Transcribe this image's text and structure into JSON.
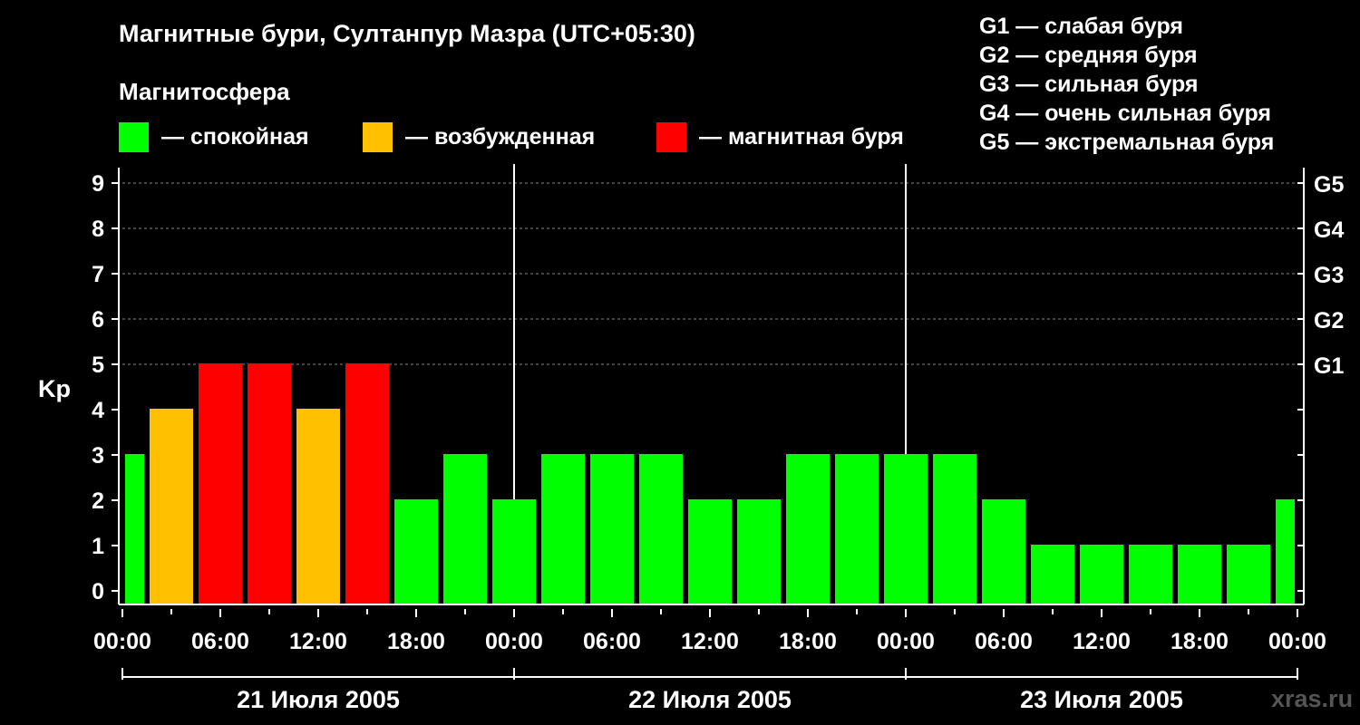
{
  "title": "Магнитные бури, Султанпур Мазра (UTC+05:30)",
  "subtitle": "Магнитосфера",
  "legend": [
    {
      "label": "— спокойная",
      "color": "#00ff00"
    },
    {
      "label": "— возбужденная",
      "color": "#ffc000"
    },
    {
      "label": "— магнитная буря",
      "color": "#ff0000"
    }
  ],
  "g_scale": [
    "G1 — слабая буря",
    "G2 — средняя буря",
    "G3 — сильная буря",
    "G4 — очень сильная буря",
    "G5 — экстремальная буря"
  ],
  "watermark": "xras.ru",
  "chart_data": {
    "type": "bar",
    "ylabel": "Kp",
    "ylim": [
      0,
      9
    ],
    "yticks": [
      "0",
      "1",
      "2",
      "3",
      "4",
      "5",
      "6",
      "7",
      "8",
      "9"
    ],
    "right_ticks": [
      {
        "value": 5,
        "label": "G1"
      },
      {
        "value": 6,
        "label": "G2"
      },
      {
        "value": 7,
        "label": "G3"
      },
      {
        "value": 8,
        "label": "G4"
      },
      {
        "value": 9,
        "label": "G5"
      }
    ],
    "xticks": [
      "00:00",
      "06:00",
      "12:00",
      "18:00",
      "00:00",
      "06:00",
      "12:00",
      "18:00",
      "00:00",
      "06:00",
      "12:00",
      "18:00",
      "00:00"
    ],
    "days": [
      "21 Июля 2005",
      "22 Июля 2005",
      "23 Июля 2005"
    ],
    "grid": "dashed horizontal lines at 5-9",
    "bars": [
      {
        "start": "21 00:00",
        "value": 3,
        "status": "calm"
      },
      {
        "start": "21 01:30",
        "value": 4,
        "status": "disturbed"
      },
      {
        "start": "21 04:30",
        "value": 5,
        "status": "storm"
      },
      {
        "start": "21 07:30",
        "value": 5,
        "status": "storm"
      },
      {
        "start": "21 10:30",
        "value": 4,
        "status": "disturbed"
      },
      {
        "start": "21 13:30",
        "value": 5,
        "status": "storm"
      },
      {
        "start": "21 16:30",
        "value": 2,
        "status": "calm"
      },
      {
        "start": "21 19:30",
        "value": 3,
        "status": "calm"
      },
      {
        "start": "21 22:30",
        "value": 2,
        "status": "calm"
      },
      {
        "start": "22 01:30",
        "value": 3,
        "status": "calm"
      },
      {
        "start": "22 04:30",
        "value": 3,
        "status": "calm"
      },
      {
        "start": "22 07:30",
        "value": 3,
        "status": "calm"
      },
      {
        "start": "22 10:30",
        "value": 2,
        "status": "calm"
      },
      {
        "start": "22 13:30",
        "value": 2,
        "status": "calm"
      },
      {
        "start": "22 16:30",
        "value": 3,
        "status": "calm"
      },
      {
        "start": "22 19:30",
        "value": 3,
        "status": "calm"
      },
      {
        "start": "22 22:30",
        "value": 3,
        "status": "calm"
      },
      {
        "start": "23 01:30",
        "value": 3,
        "status": "calm"
      },
      {
        "start": "23 04:30",
        "value": 2,
        "status": "calm"
      },
      {
        "start": "23 07:30",
        "value": 1,
        "status": "calm"
      },
      {
        "start": "23 10:30",
        "value": 1,
        "status": "calm"
      },
      {
        "start": "23 13:30",
        "value": 1,
        "status": "calm"
      },
      {
        "start": "23 16:30",
        "value": 1,
        "status": "calm"
      },
      {
        "start": "23 19:30",
        "value": 1,
        "status": "calm"
      },
      {
        "start": "23 22:30",
        "value": 2,
        "status": "calm"
      }
    ],
    "status_colors": {
      "calm": "#00ff00",
      "disturbed": "#ffc000",
      "storm": "#ff0000"
    }
  }
}
